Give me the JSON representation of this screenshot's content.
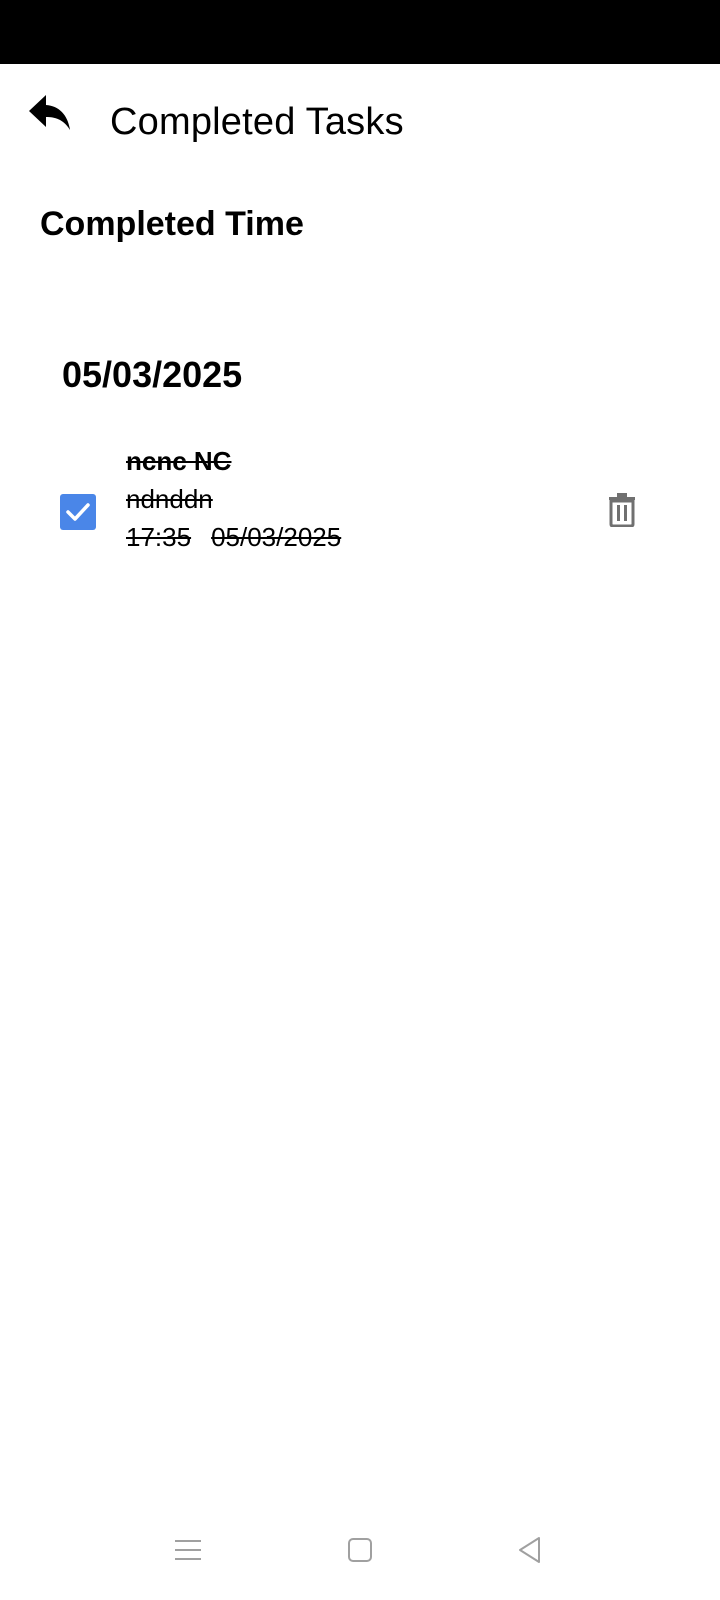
{
  "app_bar": {
    "back_icon": "reply-arrow-icon",
    "title": "Completed Tasks"
  },
  "section": {
    "heading": "Completed Time"
  },
  "groups": [
    {
      "date": "05/03/2025",
      "tasks": [
        {
          "title": "ncnc NC",
          "description": "ndnddn",
          "time": "17:35",
          "date": "05/03/2025",
          "checked": true,
          "delete_icon": "trash-icon"
        }
      ]
    }
  ],
  "nav_bar": {
    "icons": [
      "menu-icon",
      "home-square-icon",
      "back-triangle-icon"
    ]
  },
  "colors": {
    "status_bar": "#000000",
    "checkbox_fill": "#4a86e8",
    "delete_icon": "#707070",
    "nav_icon": "#a0a0a0"
  }
}
